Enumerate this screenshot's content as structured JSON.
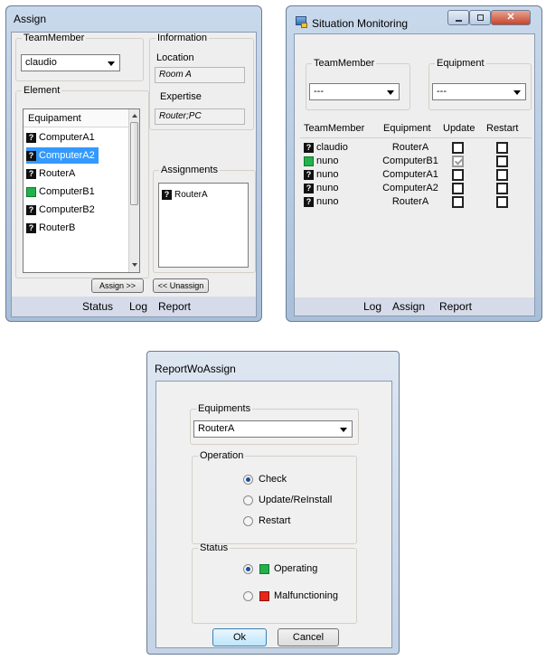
{
  "assign": {
    "title": "Assign",
    "team_member": {
      "label": "TeamMember",
      "value": "claudio"
    },
    "information": {
      "label": "Information",
      "location_label": "Location",
      "location_value": "Room A",
      "expertise_label": "Expertise",
      "expertise_value": "Router;PC"
    },
    "element": {
      "label": "Element",
      "header": "Equipament",
      "items": [
        {
          "label": "ComputerA1",
          "icon": "question-icon"
        },
        {
          "label": "ComputerA2",
          "icon": "question-icon"
        },
        {
          "label": "RouterA",
          "icon": "question-icon"
        },
        {
          "label": "ComputerB1",
          "icon": "green-status-icon"
        },
        {
          "label": "ComputerB2",
          "icon": "question-icon"
        },
        {
          "label": "RouterB",
          "icon": "question-icon"
        }
      ]
    },
    "assignments": {
      "label": "Assignments",
      "items": [
        {
          "label": "RouterA",
          "icon": "question-icon"
        }
      ]
    },
    "assign_button": "Assign >>",
    "unassign_button": "<< Unassign",
    "menu": {
      "status": "Status",
      "log": "Log",
      "report": "Report"
    }
  },
  "monitoring": {
    "title": "Situation Monitoring",
    "team_member": {
      "label": "TeamMember",
      "value": "---"
    },
    "equipment": {
      "label": "Equipment",
      "value": "---"
    },
    "columns": [
      "TeamMember",
      "Equipment",
      "Update",
      "Restart"
    ],
    "rows": [
      {
        "member": "claudio",
        "member_icon": "question-icon",
        "equipment": "RouterA",
        "update": false,
        "restart": false
      },
      {
        "member": "nuno",
        "member_icon": "green-status-icon",
        "equipment": "ComputerB1",
        "update": true,
        "restart": false
      },
      {
        "member": "nuno",
        "member_icon": "question-icon",
        "equipment": "ComputerA1",
        "update": false,
        "restart": false
      },
      {
        "member": "nuno",
        "member_icon": "question-icon",
        "equipment": "ComputerA2",
        "update": false,
        "restart": false
      },
      {
        "member": "nuno",
        "member_icon": "question-icon",
        "equipment": "RouterA",
        "update": false,
        "restart": false
      }
    ],
    "menu": {
      "log": "Log",
      "assign": "Assign",
      "report": "Report"
    }
  },
  "report": {
    "title": "ReportWoAssign",
    "equipments": {
      "label": "Equipments",
      "value": "RouterA"
    },
    "operation": {
      "label": "Operation",
      "options": [
        "Check",
        "Update/ReInstall",
        "Restart"
      ],
      "selected": "Check"
    },
    "status": {
      "label": "Status",
      "options": [
        "Operating",
        "Malfunctioning"
      ],
      "selected": "Operating"
    },
    "ok": "Ok",
    "cancel": "Cancel"
  },
  "colors": {
    "selection": "#3399ff",
    "operating": "#22b14c",
    "malfunctioning": "#e8261a"
  }
}
